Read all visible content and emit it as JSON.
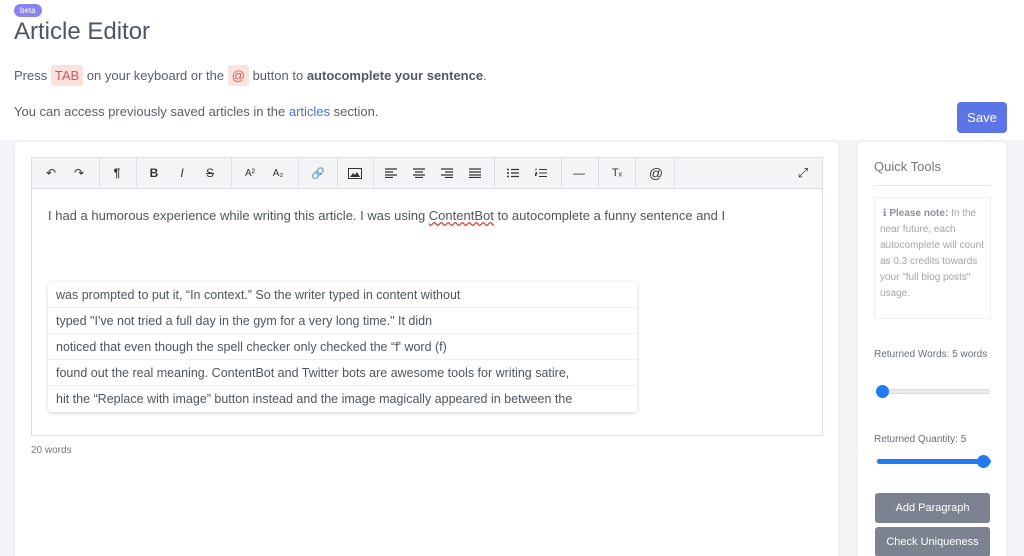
{
  "header": {
    "badge": "beta",
    "title": "Article Editor",
    "instruction_pre": "Press",
    "tab_key": "TAB",
    "instruction_mid": "on your keyboard or the",
    "at_key": "@",
    "instruction_post": "button to",
    "instruction_bold": "autocomplete your sentence",
    "instruction_end": ".",
    "access_pre": "You can access previously saved articles in the",
    "access_link": "articles",
    "access_post": "section.",
    "save_label": "Save"
  },
  "toolbar": {
    "undo": "↶",
    "redo": "↷",
    "paragraph": "¶",
    "bold": "B",
    "italic": "I",
    "strike": "S",
    "superscript": "A²",
    "subscript": "A₂",
    "link": "🔗",
    "image": "▭",
    "hr": "—",
    "clear": "Tₓ",
    "at": "@",
    "fullscreen": "⤢"
  },
  "editor": {
    "text_pre": "I had a humorous experience while writing this article. I was using ",
    "text_link": "ContentBot",
    "text_post": " to autocomplete a funny sentence and I",
    "suggestions": [
      "was prompted to put it, “In context.” So the writer typed in content without",
      "typed \"I've not tried a full day in the gym for a very long time.\" It didn",
      "noticed that even though the spell checker only checked the “f' word (f)",
      "found out the real meaning. ContentBot and Twitter bots are awesome tools for writing satire,",
      "hit the “Replace with image” button instead and the image magically appeared in between the"
    ],
    "word_count": "20 words"
  },
  "quick_tools": {
    "title": "Quick Tools",
    "note_bold": "Please note:",
    "note_text": "In the near future, each autocomplete will count as 0.3 credits towards your \"full blog posts\" usage.",
    "returned_words_label": "Returned Words: 5 words",
    "returned_words_value": 0,
    "returned_quantity_label": "Returned Quantity: 5",
    "returned_quantity_value": 1,
    "add_paragraph": "Add Paragraph",
    "check_uniqueness": "Check Uniqueness"
  },
  "colors": {
    "accent": "#5c74e6",
    "slider": "#1f7bef",
    "tool_button": "#7d8290",
    "badge": "#8a82f0"
  }
}
